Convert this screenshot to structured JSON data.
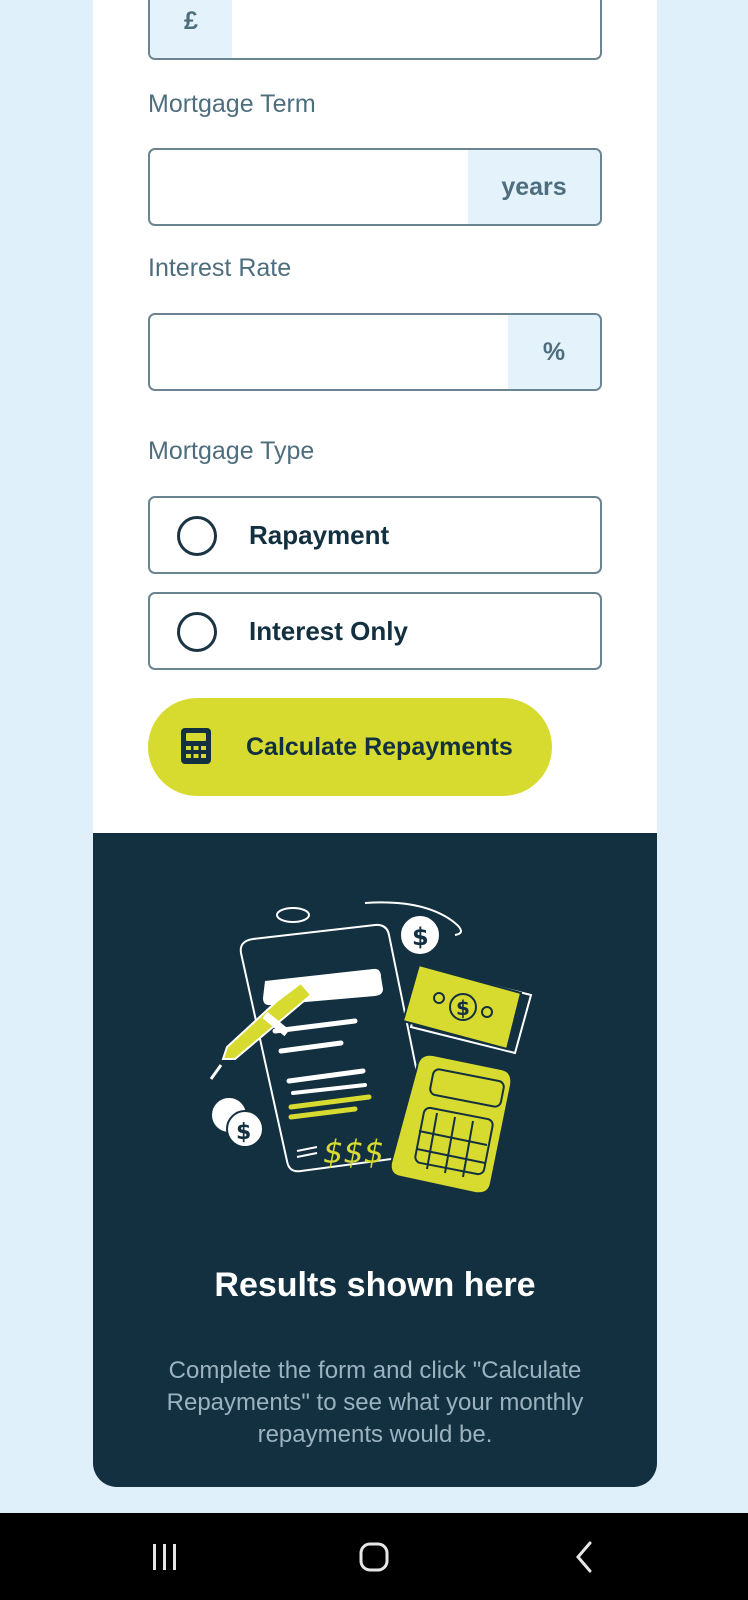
{
  "form": {
    "amount": {
      "prefix": "£",
      "value": ""
    },
    "term": {
      "label": "Mortgage Term",
      "suffix": "years",
      "value": ""
    },
    "rate": {
      "label": "Interest Rate",
      "suffix": "%",
      "value": ""
    },
    "type": {
      "label": "Mortgage Type",
      "options": [
        "Rapayment",
        "Interest Only"
      ]
    },
    "submit_label": "Calculate Repayments"
  },
  "results": {
    "title": "Results shown here",
    "description": "Complete the form and click \"Calculate Repayments\" to see what your monthly repayments would be.",
    "illustration_text": "$$$"
  },
  "colors": {
    "accent": "#d8db2f",
    "dark": "#133041",
    "page_bg": "#e0f0fa",
    "input_addon": "#e3f2fb"
  },
  "icons": {
    "calculator": "calculator-icon",
    "nav_recent": "recent-apps-icon",
    "nav_home": "home-icon",
    "nav_back": "back-icon"
  }
}
